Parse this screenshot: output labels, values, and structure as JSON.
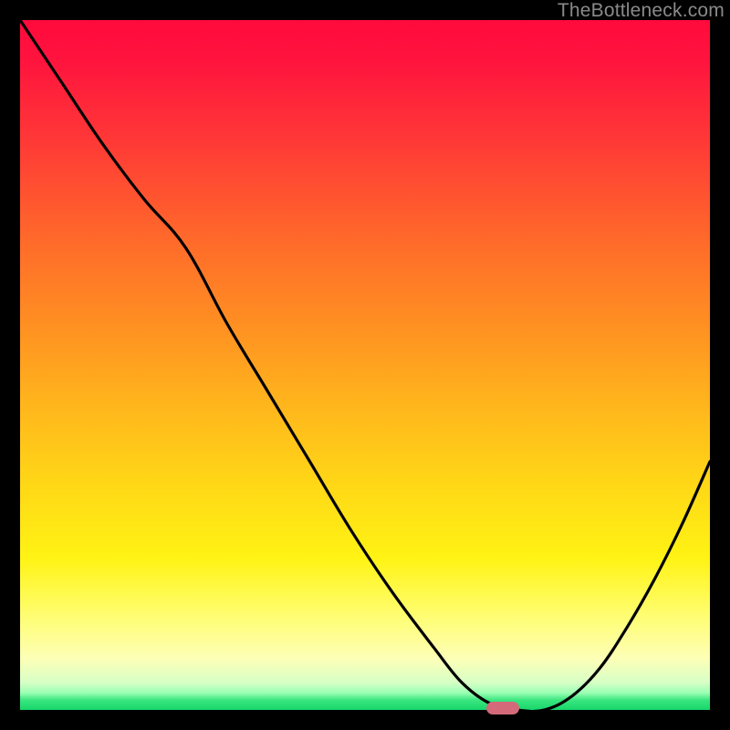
{
  "watermark": "TheBottleneck.com",
  "chart_data": {
    "type": "line",
    "title": "",
    "xlabel": "",
    "ylabel": "",
    "xlim": [
      0,
      100
    ],
    "ylim": [
      0,
      100
    ],
    "grid": false,
    "legend": false,
    "annotations": [
      "background gradient top-red to bottom-green"
    ],
    "series": [
      {
        "name": "bottleneck-curve",
        "x": [
          0,
          6,
          12,
          18,
          24,
          30,
          36,
          42,
          48,
          54,
          60,
          64,
          68,
          72,
          76,
          80,
          84,
          88,
          92,
          96,
          100
        ],
        "y": [
          100,
          91,
          82,
          74,
          67,
          56,
          46,
          36,
          26,
          17,
          9,
          4,
          1,
          0,
          0,
          2,
          6,
          12,
          19,
          27,
          36
        ]
      }
    ],
    "marker": {
      "x": 70,
      "y": 0,
      "color": "#d4697a"
    },
    "background_gradient_stops": [
      {
        "pos": 0.0,
        "color": "#ff0a3c"
      },
      {
        "pos": 0.18,
        "color": "#ff3a36"
      },
      {
        "pos": 0.44,
        "color": "#ff8f22"
      },
      {
        "pos": 0.68,
        "color": "#ffd916"
      },
      {
        "pos": 0.86,
        "color": "#fffd6e"
      },
      {
        "pos": 0.975,
        "color": "#9cffb4"
      },
      {
        "pos": 1.0,
        "color": "#17d76a"
      }
    ]
  }
}
